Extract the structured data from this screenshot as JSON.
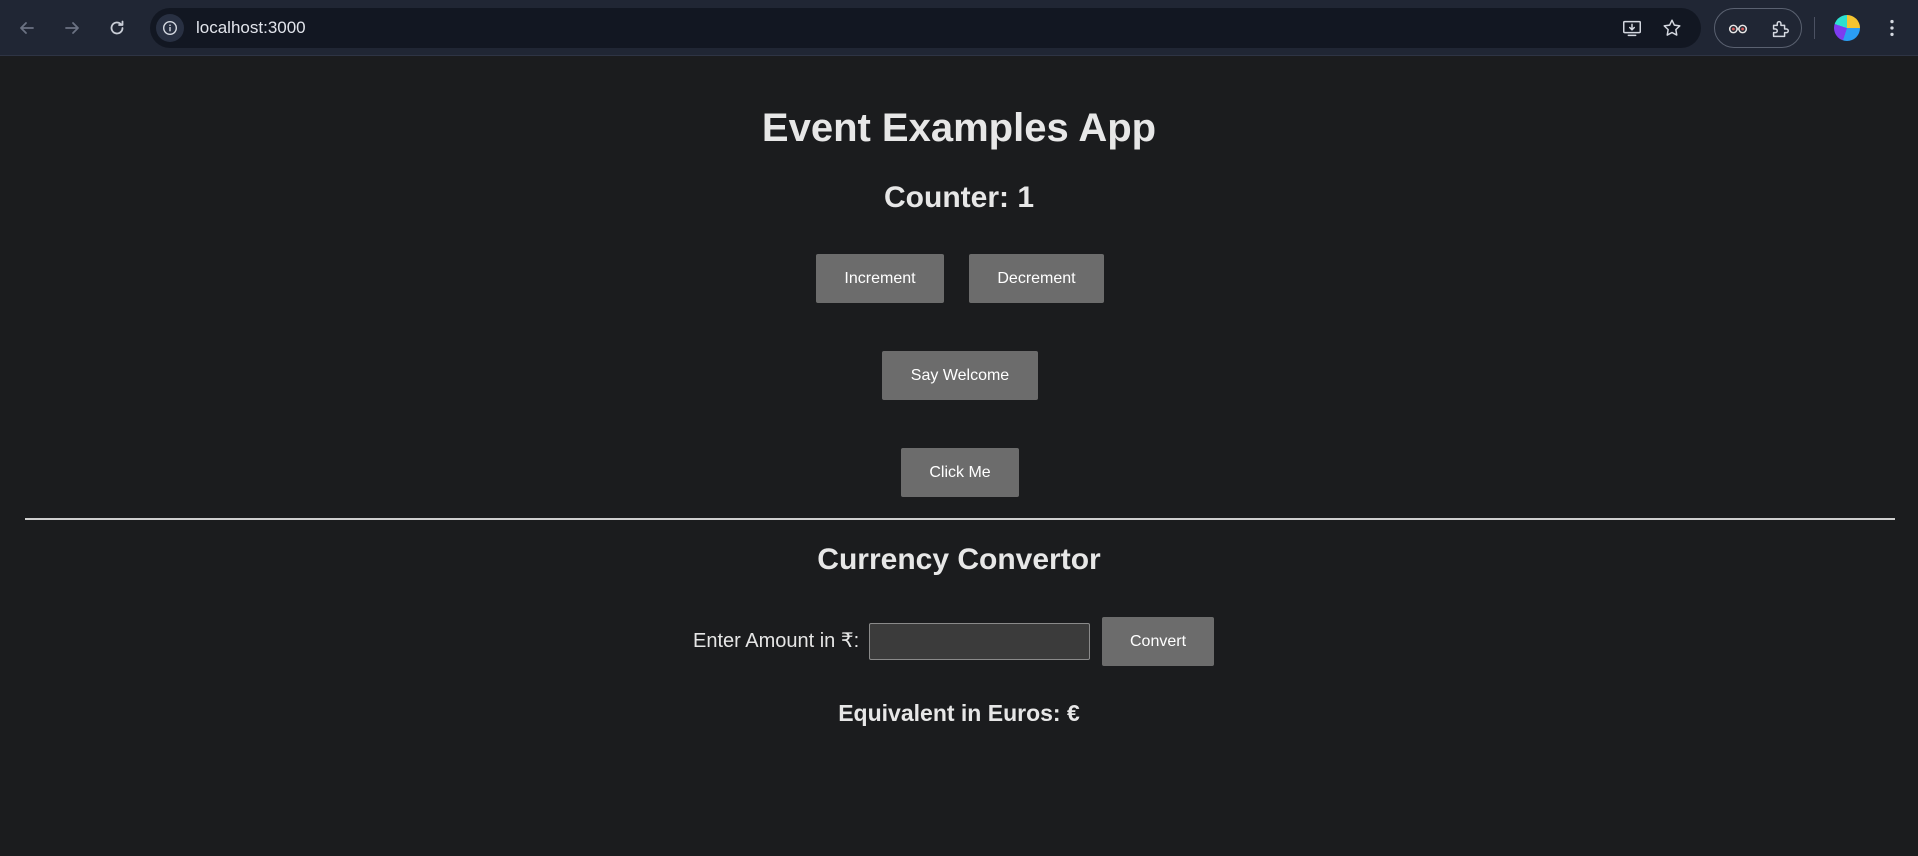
{
  "browser": {
    "url": "localhost:3000",
    "icons": {
      "back": "arrow-left-icon",
      "forward": "arrow-right-icon",
      "reload": "reload-icon",
      "site_info": "info-icon",
      "install": "install-app-icon",
      "bookmark": "star-icon",
      "extension_1": "glasses-extension-icon",
      "extensions": "puzzle-icon",
      "profile": "profile-avatar",
      "menu": "kebab-menu-icon"
    }
  },
  "app": {
    "title": "Event Examples App",
    "counter_text": "Counter: 1",
    "increment_label": "Increment",
    "decrement_label": "Decrement",
    "welcome_label": "Say Welcome",
    "click_me_label": "Click Me"
  },
  "converter": {
    "title": "Currency Convertor",
    "amount_label": "Enter Amount in ₹:",
    "amount_value": "",
    "convert_label": "Convert",
    "result_text": "Equivalent in Euros: €"
  },
  "colors": {
    "page_background": "#1b1c1e",
    "button_background": "#6c6c6c",
    "toolbar_background": "#202634"
  }
}
